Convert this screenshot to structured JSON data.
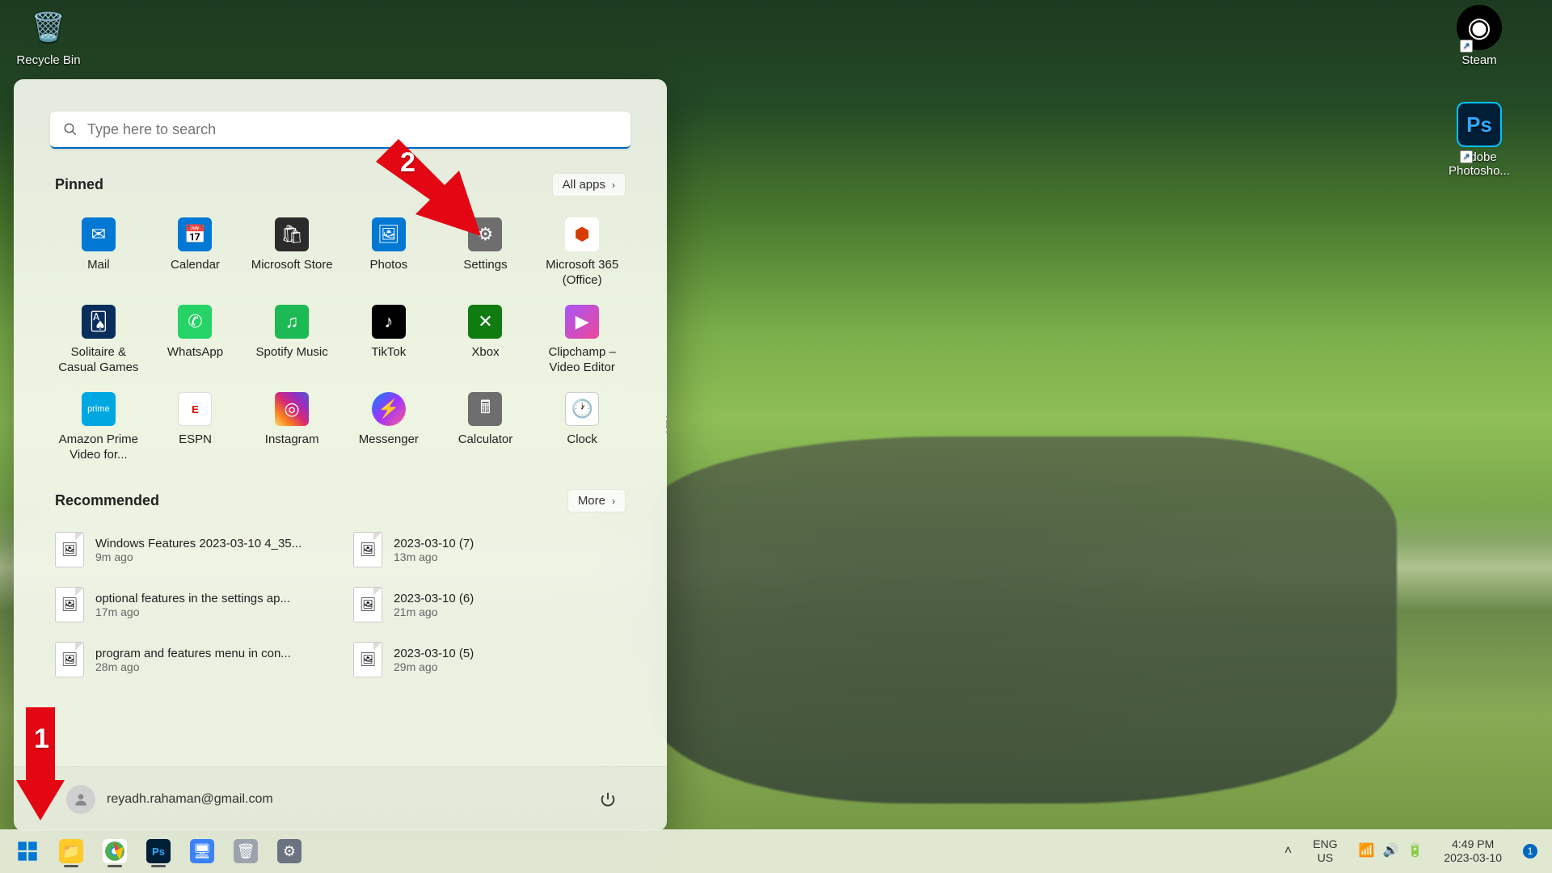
{
  "desktop": {
    "recycle": "Recycle Bin",
    "steam": "Steam",
    "photoshop": "Adobe Photosho..."
  },
  "start": {
    "search_placeholder": "Type here to search",
    "pinned_title": "Pinned",
    "all_apps": "All apps",
    "recommended_title": "Recommended",
    "more": "More",
    "user": "reyadh.rahaman@gmail.com",
    "pinned": [
      {
        "label": "Mail"
      },
      {
        "label": "Calendar"
      },
      {
        "label": "Microsoft Store"
      },
      {
        "label": "Photos"
      },
      {
        "label": "Settings"
      },
      {
        "label": "Microsoft 365 (Office)"
      },
      {
        "label": "Solitaire & Casual Games"
      },
      {
        "label": "WhatsApp"
      },
      {
        "label": "Spotify Music"
      },
      {
        "label": "TikTok"
      },
      {
        "label": "Xbox"
      },
      {
        "label": "Clipchamp – Video Editor"
      },
      {
        "label": "Amazon Prime Video for..."
      },
      {
        "label": "ESPN"
      },
      {
        "label": "Instagram"
      },
      {
        "label": "Messenger"
      },
      {
        "label": "Calculator"
      },
      {
        "label": "Clock"
      }
    ],
    "recommended": [
      {
        "name": "Windows Features 2023-03-10 4_35...",
        "time": "9m ago"
      },
      {
        "name": "2023-03-10 (7)",
        "time": "13m ago"
      },
      {
        "name": "optional features in the settings ap...",
        "time": "17m ago"
      },
      {
        "name": "2023-03-10 (6)",
        "time": "21m ago"
      },
      {
        "name": "program and features menu in con...",
        "time": "28m ago"
      },
      {
        "name": "2023-03-10 (5)",
        "time": "29m ago"
      }
    ]
  },
  "annotations": {
    "a1": "1",
    "a2": "2"
  },
  "taskbar": {
    "lang1": "ENG",
    "lang2": "US",
    "time": "4:49 PM",
    "date": "2023-03-10",
    "notif": "1"
  }
}
